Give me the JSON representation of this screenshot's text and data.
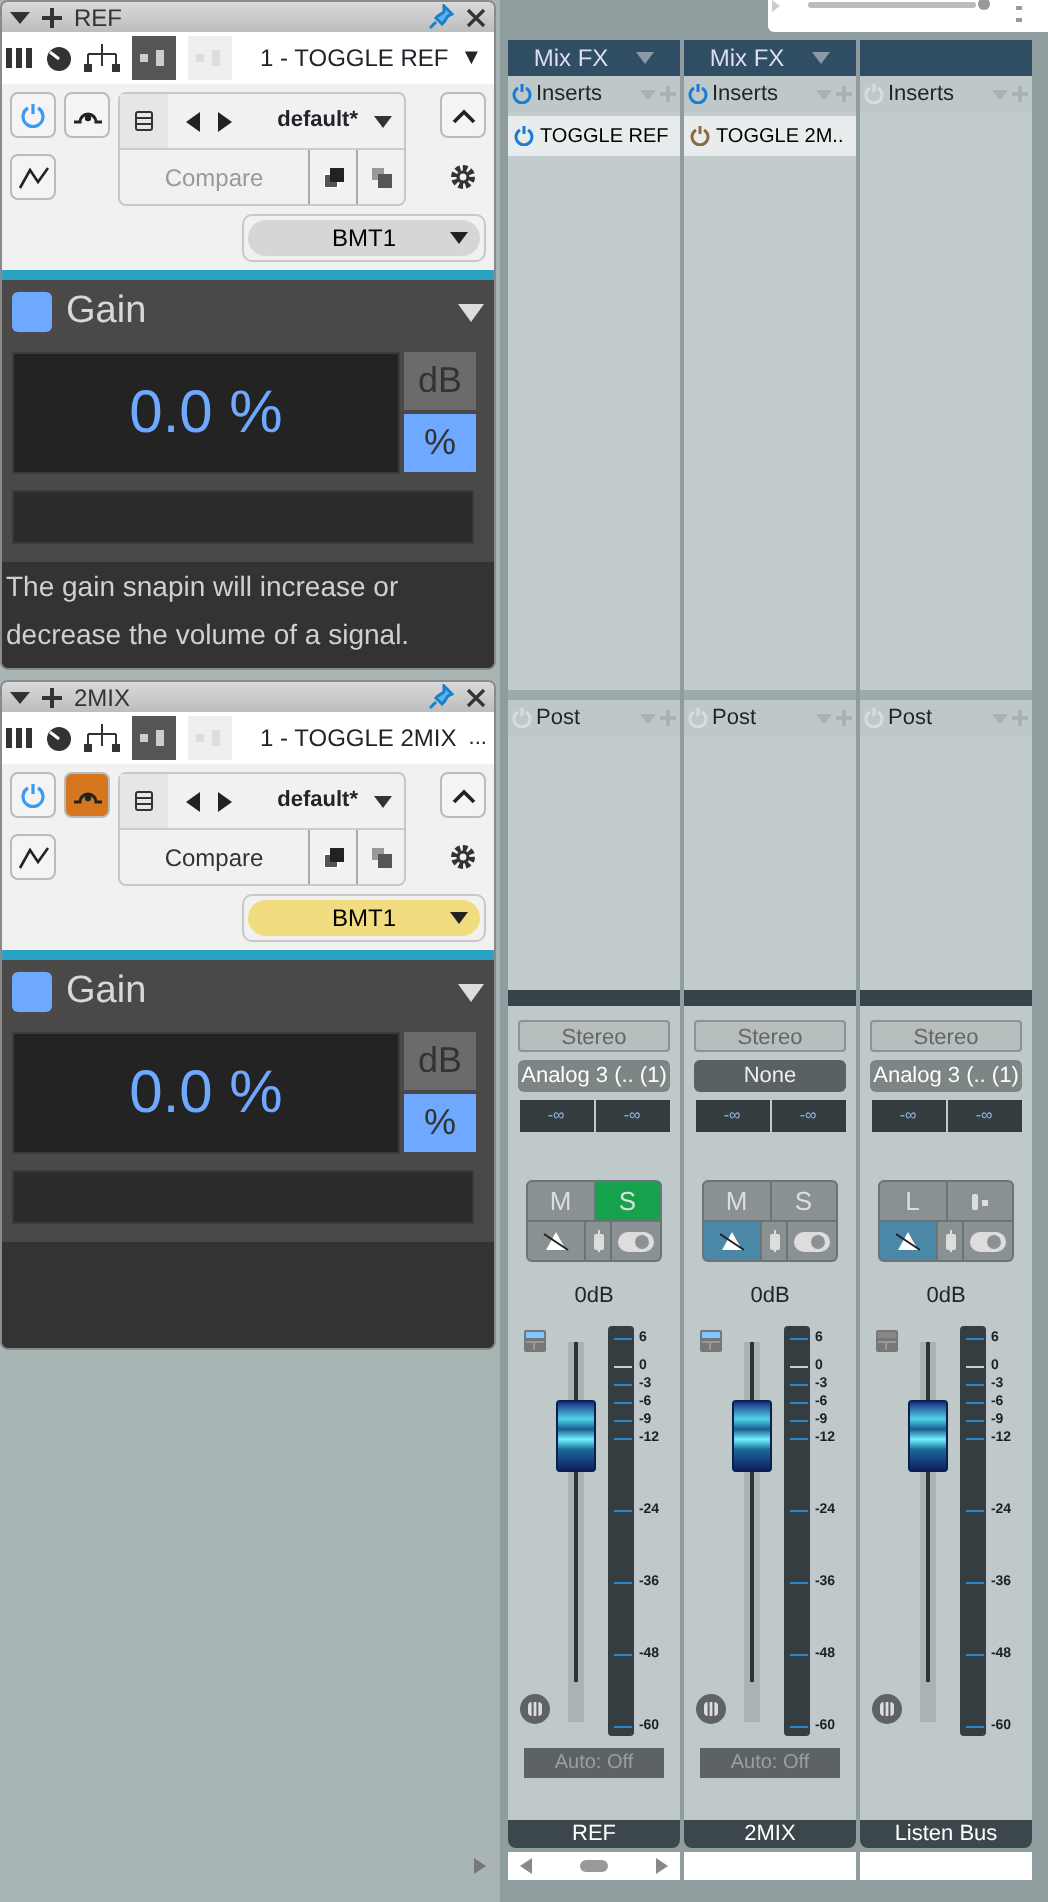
{
  "plugins": [
    {
      "title": "REF",
      "preset_slot": "1 - TOGGLE REF",
      "slot_menu": "▼",
      "power_on": true,
      "bypass_on": false,
      "preset": "default*",
      "compare": "Compare",
      "compare_disabled": true,
      "sidechain": "BMT1",
      "color": "#d6d6d6",
      "gain": {
        "title": "Gain",
        "enabled": true,
        "value": "0.0 %",
        "units": [
          {
            "label": "dB",
            "selected": false
          },
          {
            "label": "%",
            "selected": true
          }
        ],
        "description": "The gain snapin will increase or decrease the volume of a signal."
      }
    },
    {
      "title": "2MIX",
      "preset_slot": "1 - TOGGLE 2MIX",
      "slot_menu": "...",
      "power_on": true,
      "bypass_on": true,
      "preset": "default*",
      "compare": "Compare",
      "compare_disabled": false,
      "sidechain": "BMT1",
      "color": "#f2dc80",
      "gain": {
        "title": "Gain",
        "enabled": true,
        "value": "0.0 %",
        "units": [
          {
            "label": "dB",
            "selected": false
          },
          {
            "label": "%",
            "selected": true
          }
        ]
      }
    }
  ],
  "channels": [
    {
      "fx_header": "Mix FX",
      "inserts": {
        "label": "Inserts",
        "on": true
      },
      "insert_items": [
        {
          "name": "TOGGLE REF",
          "on": true
        }
      ],
      "post": "Post",
      "input": "Stereo",
      "routing": "Analog 3 (.. (1)",
      "routing_active": true,
      "levels": [
        "-∞",
        "-∞"
      ],
      "buttons": [
        {
          "kind": "text",
          "label": "M",
          "on": false
        },
        {
          "kind": "text",
          "label": "S",
          "on": true
        }
      ],
      "monitor_on": false,
      "volume": "0dB",
      "select_on": true,
      "fader": {
        "level": 0.75
      },
      "meter_scale": [
        "6",
        "0",
        "-3",
        "-6",
        "-9",
        "-12",
        "-24",
        "-36",
        "-48",
        "-60"
      ],
      "automation": "Auto: Off",
      "name": "REF"
    },
    {
      "fx_header": "Mix FX",
      "inserts": {
        "label": "Inserts",
        "on": true
      },
      "insert_items": [
        {
          "name": "TOGGLE 2M..",
          "on": false
        }
      ],
      "post": "Post",
      "input": "Stereo",
      "routing": "None",
      "routing_active": false,
      "levels": [
        "-∞",
        "-∞"
      ],
      "buttons": [
        {
          "kind": "text",
          "label": "M",
          "on": false
        },
        {
          "kind": "text",
          "label": "S",
          "on": false
        }
      ],
      "monitor_on": true,
      "volume": "0dB",
      "select_on": true,
      "fader": {
        "level": 0.75
      },
      "meter_scale": [
        "6",
        "0",
        "-3",
        "-6",
        "-9",
        "-12",
        "-24",
        "-36",
        "-48",
        "-60"
      ],
      "automation": "Auto: Off",
      "name": "2MIX"
    },
    {
      "inserts": {
        "label": "Inserts",
        "on": false
      },
      "post": "Post",
      "input": "Stereo",
      "routing": "Analog 3 (.. (1)",
      "routing_active": true,
      "levels": [
        "-∞",
        "-∞"
      ],
      "buttons": [
        {
          "kind": "text",
          "label": "L",
          "on": false
        },
        {
          "kind": "icon",
          "on": false
        }
      ],
      "monitor_on": true,
      "volume": "0dB",
      "select_on": false,
      "fader": {
        "level": 0.75
      },
      "meter_scale": [
        "6",
        "0",
        "-3",
        "-6",
        "-9",
        "-12",
        "-24",
        "-36",
        "-48",
        "-60"
      ],
      "name": "Listen Bus"
    }
  ]
}
